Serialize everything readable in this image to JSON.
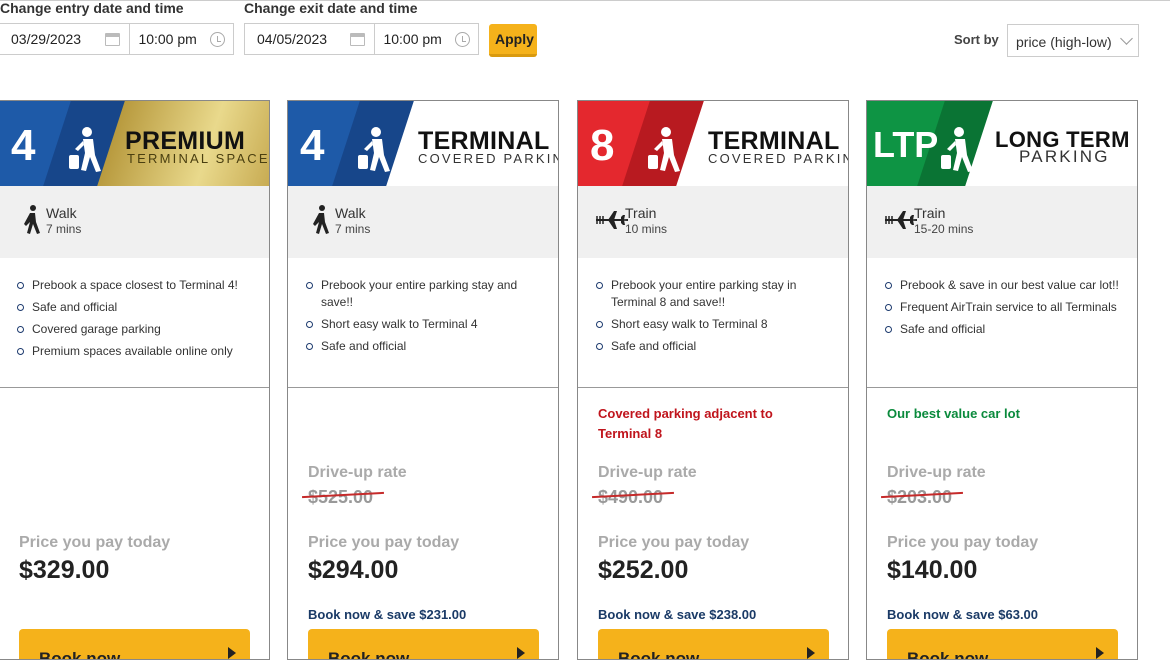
{
  "entry": {
    "label": "Change entry date and time",
    "date": "03/29/2023",
    "time": "10:00 pm"
  },
  "exit": {
    "label": "Change exit date and time",
    "date": "04/05/2023",
    "time": "10:00 pm"
  },
  "apply_label": "Apply",
  "sort": {
    "label": "Sort by",
    "value": "price (high-low)"
  },
  "book_label": "Book now",
  "cards": [
    {
      "badge": "4",
      "title": "PREMIUM",
      "subtitle": "TERMINAL SPACE",
      "transport_mode": "Walk",
      "transport_time": "7 mins",
      "transport_icon": "walk-icon",
      "features": [
        "Prebook a space closest to Terminal 4!",
        "Safe and official",
        "Covered garage parking",
        "Premium spaces available online only"
      ],
      "highlight": "",
      "drive_label": "",
      "drive_price": "",
      "pay_label": "Price you pay today",
      "price": "$329.00",
      "savings": "",
      "colors": {
        "primary": "#1e5aa8",
        "secondary": "#c9a948"
      }
    },
    {
      "badge": "4",
      "title": "TERMINAL",
      "subtitle": "COVERED PARKING",
      "transport_mode": "Walk",
      "transport_time": "7 mins",
      "transport_icon": "walk-icon",
      "features": [
        "Prebook your entire parking stay and save!!",
        "Short easy walk to Terminal 4",
        "Safe and official"
      ],
      "highlight": "",
      "drive_label": "Drive-up rate",
      "drive_price": "$525.00",
      "pay_label": "Price you pay today",
      "price": "$294.00",
      "savings": "Book now & save $231.00",
      "colors": {
        "primary": "#1e5aa8"
      }
    },
    {
      "badge": "8",
      "title": "TERMINAL",
      "subtitle": "COVERED PARKING",
      "transport_mode": "Train",
      "transport_time": "10 mins",
      "transport_icon": "train-plane-icon",
      "features": [
        "Prebook your entire parking stay in Terminal 8 and save!!",
        "Short easy walk to Terminal 8",
        "Safe and official"
      ],
      "highlight": "Covered parking adjacent to Terminal 8",
      "highlight_color": "#c0141c",
      "drive_label": "Drive-up rate",
      "drive_price": "$490.00",
      "pay_label": "Price you pay today",
      "price": "$252.00",
      "savings": "Book now & save $238.00",
      "colors": {
        "primary": "#e4282e"
      }
    },
    {
      "badge": "LTP",
      "title": "LONG TERM",
      "subtitle": "PARKING",
      "transport_mode": "Train",
      "transport_time": "15-20 mins",
      "transport_icon": "train-plane-icon",
      "features": [
        "Prebook & save in our best value car lot!!",
        "Frequent AirTrain service to all Terminals",
        "Safe and official"
      ],
      "highlight": "Our best value car lot",
      "highlight_color": "#0a8a3c",
      "drive_label": "Drive-up rate",
      "drive_price": "$203.00",
      "pay_label": "Price you pay today",
      "price": "$140.00",
      "savings": "Book now & save $63.00",
      "colors": {
        "primary": "#0e9444"
      }
    }
  ]
}
